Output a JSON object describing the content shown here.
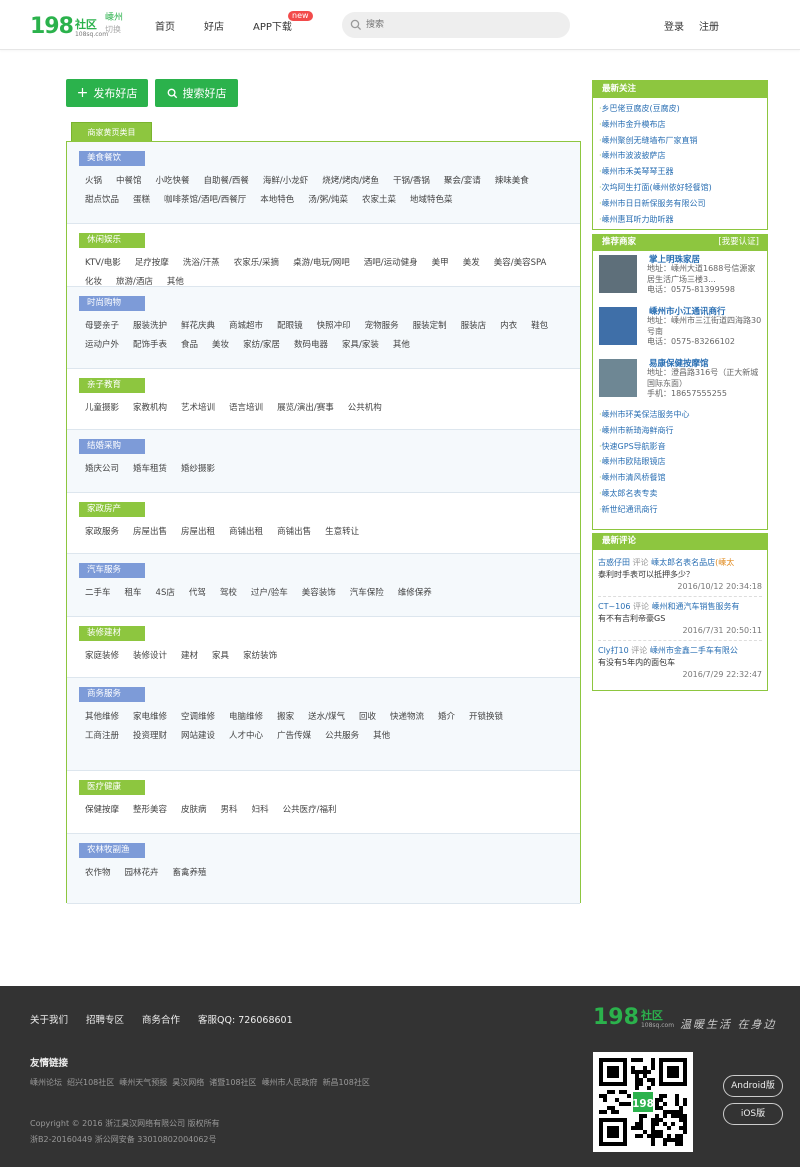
{
  "header": {
    "logo_num": "198",
    "logo_text": "社区",
    "logo_sub": "108sq.com",
    "city": "嵊州",
    "city_switch": "切换",
    "nav": [
      "首页",
      "好店",
      "APP下载"
    ],
    "new_badge": "new",
    "search_placeholder": "搜索",
    "login": "登录",
    "register": "注册"
  },
  "actions": {
    "publish": "发布好店",
    "search_shop": "搜索好店"
  },
  "tab_label": "商家黄页类目",
  "categories": [
    {
      "name": "美食餐饮",
      "color": "#7d9bd8",
      "tags": [
        "火锅",
        "中餐馆",
        "小吃快餐",
        "自助餐/西餐",
        "海鲜/小龙虾",
        "烧烤/烤肉/烤鱼",
        "干锅/香锅",
        "聚会/宴请",
        "辣味美食",
        "甜点饮品",
        "蛋糕",
        "咖啡茶馆/酒吧/西餐厅",
        "本地特色",
        "汤/粥/炖菜",
        "农家土菜",
        "地域特色菜"
      ]
    },
    {
      "name": "休闲娱乐",
      "color": "#8dc63f",
      "tags": [
        "KTV/电影",
        "足疗按摩",
        "洗浴/汗蒸",
        "农家乐/采摘",
        "桌游/电玩/网吧",
        "酒吧/运动健身",
        "美甲",
        "美发",
        "美容/美容SPA",
        "化妆",
        "旅游/酒店",
        "其他"
      ]
    },
    {
      "name": "时尚购物",
      "color": "#7d9bd8",
      "tags": [
        "母婴亲子",
        "服装洗护",
        "鲜花庆典",
        "商城超市",
        "配眼镜",
        "快照冲印",
        "宠物服务",
        "服装定制",
        "服装店",
        "内衣",
        "鞋包",
        "运动户外",
        "配饰手表",
        "食品",
        "美妆",
        "家纺/家居",
        "数码电器",
        "家具/家装",
        "其他"
      ]
    },
    {
      "name": "亲子教育",
      "color": "#8dc63f",
      "tags": [
        "儿童摄影",
        "家教机构",
        "艺术培训",
        "语言培训",
        "展览/演出/赛事",
        "公共机构"
      ]
    },
    {
      "name": "结婚采购",
      "color": "#7d9bd8",
      "tags": [
        "婚庆公司",
        "婚车租赁",
        "婚纱摄影"
      ]
    },
    {
      "name": "家政房产",
      "color": "#8dc63f",
      "tags": [
        "家政服务",
        "房屋出售",
        "房屋出租",
        "商铺出租",
        "商铺出售",
        "生意转让"
      ]
    },
    {
      "name": "汽车服务",
      "color": "#7d9bd8",
      "tags": [
        "二手车",
        "租车",
        "4S店",
        "代驾",
        "驾校",
        "过户/验车",
        "美容装饰",
        "汽车保险",
        "维修保养"
      ]
    },
    {
      "name": "装修建材",
      "color": "#8dc63f",
      "tags": [
        "家庭装修",
        "装修设计",
        "建材",
        "家具",
        "家纺装饰"
      ]
    },
    {
      "name": "商务服务",
      "color": "#7d9bd8",
      "tags": [
        "其他维修",
        "家电维修",
        "空调维修",
        "电脑维修",
        "搬家",
        "送水/煤气",
        "回收",
        "快递物流",
        "婚介",
        "开锁换锁",
        "工商注册",
        "投资理财",
        "网站建设",
        "人才中心",
        "广告传媒",
        "公共服务",
        "其他"
      ]
    },
    {
      "name": "医疗健康",
      "color": "#8dc63f",
      "tags": [
        "保健按摩",
        "整形美容",
        "皮肤病",
        "男科",
        "妇科",
        "公共医疗/福利"
      ]
    },
    {
      "name": "农林牧副渔",
      "color": "#7d9bd8",
      "tags": [
        "农作物",
        "园林花卉",
        "畜禽养殖"
      ]
    }
  ],
  "latest_follow": {
    "title": "最新关注",
    "items": [
      "乡巴佬豆腐皮(豆腐皮)",
      "嵊州市金升模布店",
      "嵊州聚创无缝墙布厂家直销",
      "嵊州市波波披萨店",
      "嵊州市禾美琴琴王器",
      "次坞阿生打面(嵊州依好轻餐馆)",
      "嵊州市日日新保服务有限公司",
      "嵊州惠耳听力助听器"
    ]
  },
  "recommend": {
    "title": "推荐商家",
    "link": "[我要认证]",
    "shops": [
      {
        "name": "掌上明珠家居",
        "addr": "地址：嵊州大道1688号信源家居生活广场三楼3...",
        "phone": "电话：0575-81399598"
      },
      {
        "name": "嵊州市小江通讯商行",
        "addr": "地址：嵊州市三江街道四海路30号南",
        "phone": "电话：0575-83266102"
      },
      {
        "name": "易康保健按摩馆",
        "addr": "地址：澄昌路316号（正大新城国际东面）",
        "phone": "手机：18657555255"
      }
    ],
    "more": [
      "嵊州市环美保洁服务中心",
      "嵊州市新琦海鲜商行",
      "快速GPS导航影音",
      "嵊州市欧陆眼镜店",
      "嵊州市清风桥餐馆",
      "嵊太郎名表专卖",
      "新世纪通讯商行"
    ]
  },
  "comments": {
    "title": "最新评论",
    "items": [
      {
        "user": "古惑仔田",
        "verb": "评论",
        "target": "嵊太郎名表名品店",
        "extra": "(嵊太",
        "text": "泰利时手表可以抵押多少？",
        "time": "2016/10/12 20:34:18"
      },
      {
        "user": "CT~106",
        "verb": "评论",
        "target": "嵊州和通汽车销售服务有",
        "extra": "",
        "text": "有不有吉利帝豪GS",
        "time": "2016/7/31 20:50:11"
      },
      {
        "user": "Cly打10",
        "verb": "评论",
        "target": "嵊州市金鑫二手车有限公",
        "extra": "",
        "text": "有没有5年内的面包车",
        "time": "2016/7/29 22:32:47"
      }
    ]
  },
  "footer": {
    "links": [
      "关于我们",
      "招聘专区",
      "商务合作",
      "客服QQ: 726068601"
    ],
    "friend_title": "友情链接",
    "friends": [
      "嵊州论坛",
      "绍兴108社区",
      "嵊州天气预报",
      "昊汉网络",
      "诸暨108社区",
      "嵊州市人民政府",
      "新昌108社区"
    ],
    "copyright": "Copyright © 2016 浙江昊汉网络有限公司 版权所有",
    "icp": "浙B2-20160449  浙公网安备 33010802004062号",
    "slogan": "温暖生活 在身边",
    "android": "Android版",
    "ios": "iOS版",
    "qr_center": "198"
  }
}
